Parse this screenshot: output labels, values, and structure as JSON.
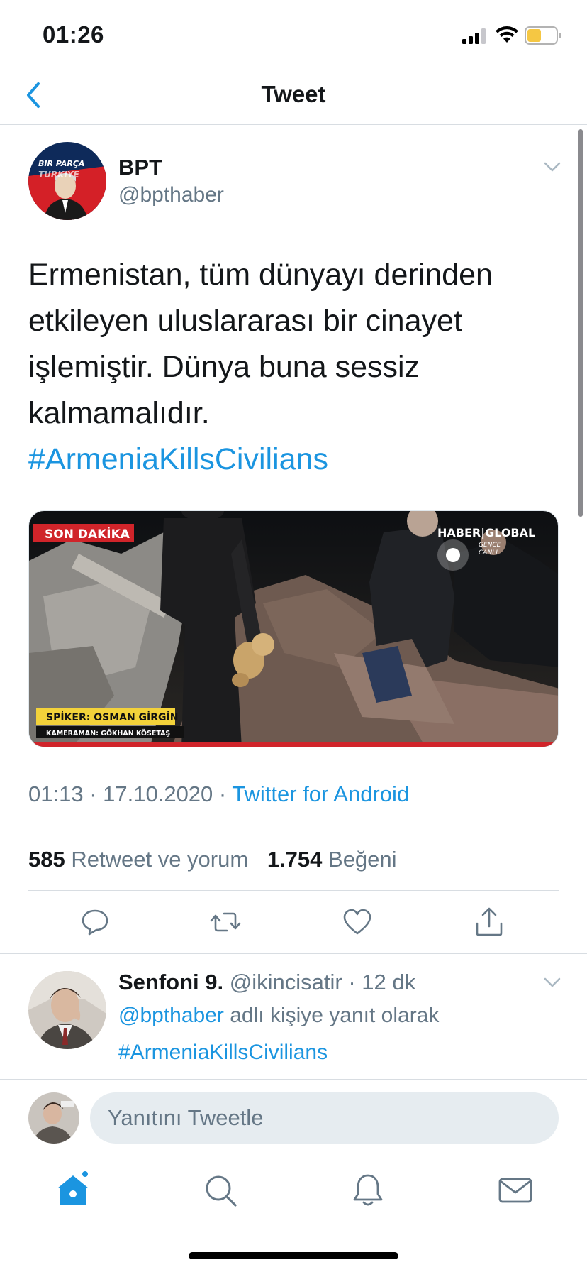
{
  "status_bar": {
    "time": "01:26",
    "battery_color": "#f5c743"
  },
  "nav": {
    "title": "Tweet",
    "back_icon": "chevron-left-icon"
  },
  "tweet": {
    "author_name": "BPT",
    "author_handle": "@bpthaber",
    "avatar_text_1": "BIR PARÇA",
    "avatar_text_2": "TURKIYE",
    "text_lines": [
      "Ermenistan, tüm dünyayı derinden",
      "etkileyen uluslararası bir cinayet",
      "işlemiştir. Dünya buna sessiz",
      "kalmamalıdır."
    ],
    "hashtag": "#ArmeniaKillsCivilians",
    "media": {
      "badge": "SON DAKİKA",
      "channel": "HABER|GLOBAL",
      "channel_sub_1": "GENCE",
      "channel_sub_2": "CANLI",
      "anchor": "SPİKER: OSMAN GİRGİN",
      "camera": "KAMERAMAN: GÖKHAN KÖSETAŞ"
    },
    "time": "01:13",
    "date": "17.10.2020",
    "source": "Twitter for Android",
    "retweet_count": "585",
    "retweet_label": "Retweet ve yorum",
    "like_count": "1.754",
    "like_label": "Beğeni"
  },
  "reply": {
    "name": "Senfoni 9.",
    "handle": "@ikincisatir",
    "age": "12 dk",
    "mention": "@bpthaber",
    "context": "adlı kişiye yanıt olarak",
    "hashtag": "#ArmeniaKillsCivilians"
  },
  "compose": {
    "placeholder": "Yanıtını Tweetle"
  },
  "tabs": [
    "home-icon",
    "search-icon",
    "notifications-icon",
    "messages-icon"
  ],
  "colors": {
    "accent": "#1b95e0",
    "secondary_text": "#657786",
    "primary_text": "#14171a"
  }
}
